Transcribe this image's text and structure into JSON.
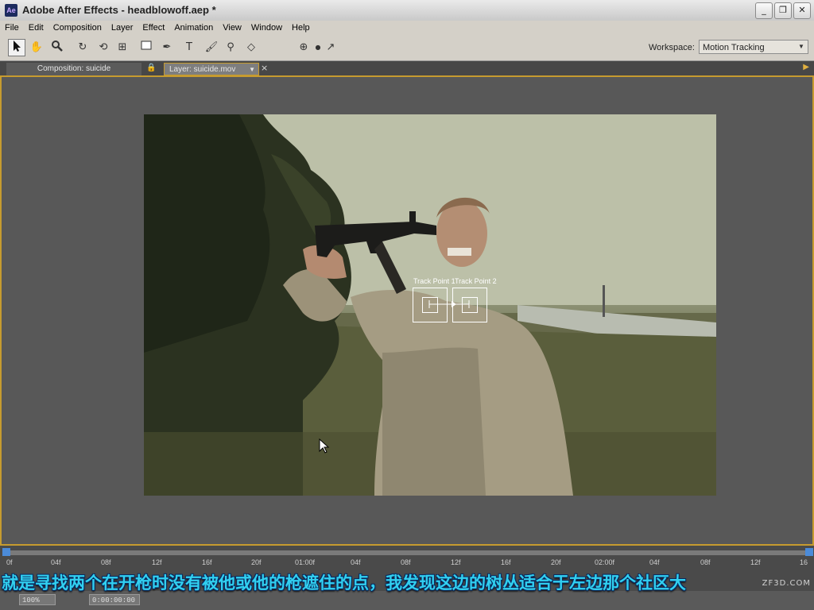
{
  "window": {
    "title": "Adobe After Effects - headblowoff.aep *",
    "app_icon": "Ae",
    "minimize_glyph": "_",
    "maximize_glyph": "❐",
    "close_glyph": "✕"
  },
  "menu": [
    "File",
    "Edit",
    "Composition",
    "Layer",
    "Effect",
    "Animation",
    "View",
    "Window",
    "Help"
  ],
  "toolbar": {
    "tools": [
      "selection-tool",
      "hand-tool",
      "zoom-tool",
      "rotation-tool",
      "orbit-camera-tool",
      "pan-behind-tool",
      "rectangle-mask-tool",
      "pen-tool",
      "type-tool",
      "brush-tool",
      "clone-stamp-tool",
      "eraser-tool",
      "axis-tool"
    ],
    "workspace_label": "Workspace:",
    "workspace_value": "Motion Tracking"
  },
  "tabs": {
    "composition": "Composition: suicide",
    "layer": "Layer: suicide.mov"
  },
  "viewer": {
    "track_point_1_label": "Track Point 1",
    "track_point_2_label": "Track Point 2"
  },
  "timeline": {
    "ticks": [
      "0f",
      "04f",
      "08f",
      "12f",
      "16f",
      "20f",
      "01:00f",
      "04f",
      "08f",
      "12f",
      "16f",
      "20f",
      "02:00f",
      "04f",
      "08f",
      "12f",
      "16"
    ]
  },
  "status": {
    "zoom": "100%",
    "time": "0:00:00:00"
  },
  "subtitle": "就是寻找两个在开枪时没有被他或他的枪遮住的点，我发现这边的树丛适合于左边那个社区大",
  "watermark": "ZF3D.COM",
  "colors": {
    "accent": "#c69b2f",
    "subtitle": "#31d0f0",
    "timeline_marker": "#4b8bd9"
  }
}
